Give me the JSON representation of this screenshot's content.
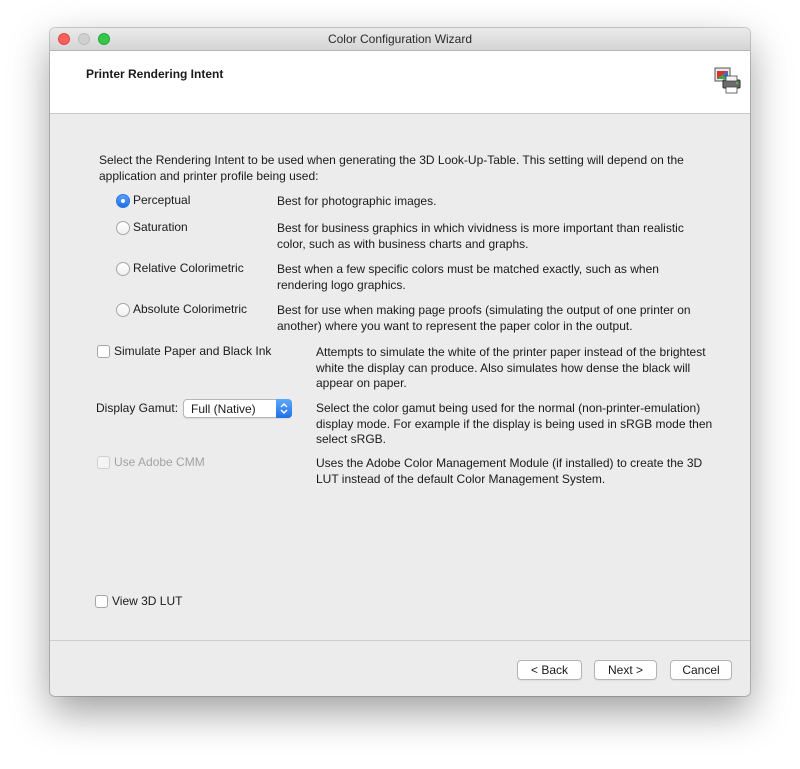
{
  "window": {
    "title": "Color Configuration Wizard"
  },
  "header": {
    "title": "Printer Rendering Intent",
    "icon": "printer-color-icon"
  },
  "intro": "Select the Rendering Intent to be used when generating the 3D Look-Up-Table. This setting will depend on the application and printer profile being used:",
  "intents": [
    {
      "label": "Perceptual",
      "description": "Best for photographic images.",
      "selected": true
    },
    {
      "label": "Saturation",
      "description": "Best for business graphics in which vividness is more important than realistic color, such as with business charts and graphs.",
      "selected": false
    },
    {
      "label": "Relative Colorimetric",
      "description": "Best when a few specific colors must be matched exactly, such as when rendering logo graphics.",
      "selected": false
    },
    {
      "label": "Absolute Colorimetric",
      "description": "Best for use when making page proofs (simulating the output of one printer on another) where you want to represent the paper color in the output.",
      "selected": false
    }
  ],
  "simulate_paper": {
    "label": "Simulate Paper and Black Ink",
    "description": "Attempts to simulate the white of the printer paper instead of the brightest white the display can produce. Also simulates how dense the black will appear on paper.",
    "checked": false
  },
  "display_gamut": {
    "label": "Display Gamut:",
    "value": "Full (Native)",
    "description": "Select the color gamut being used for the normal (non-printer-emulation) display mode. For example if the display is being used in sRGB mode then select sRGB."
  },
  "adobe_cmm": {
    "label": "Use Adobe CMM",
    "description": "Uses the Adobe Color Management Module (if installed) to create the 3D LUT instead of the default Color Management System.",
    "checked": false,
    "enabled": false
  },
  "view_lut": {
    "label": "View 3D LUT",
    "checked": false
  },
  "buttons": {
    "back": "< Back",
    "next": "Next >",
    "cancel": "Cancel"
  },
  "colors": {
    "accent": "#1f6fe6",
    "close": "#fc605c",
    "zoom": "#34c84a"
  }
}
